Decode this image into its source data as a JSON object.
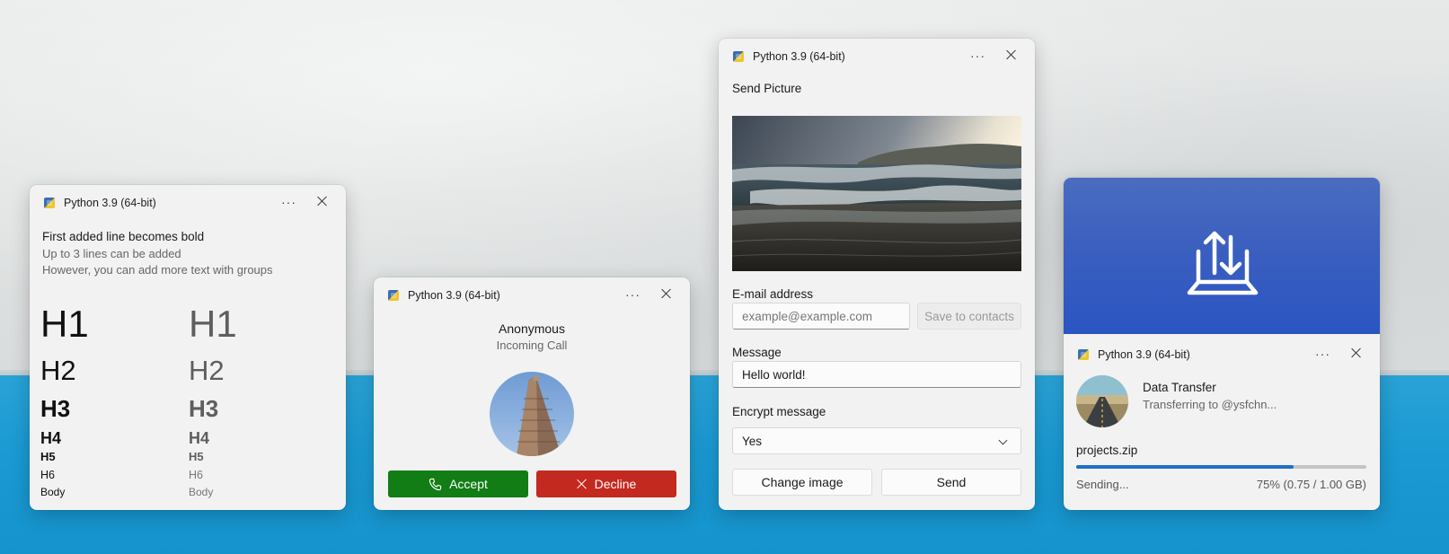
{
  "app_name": "Python 3.9 (64-bit)",
  "header": {
    "more_label": "···"
  },
  "toast_text": {
    "line1": "First added line becomes bold",
    "line2": "Up to 3 lines can be added",
    "line3": "However, you can add more text with groups",
    "headings": [
      "H1",
      "H2",
      "H3",
      "H4",
      "H5",
      "H6",
      "Body"
    ]
  },
  "toast_call": {
    "caller": "Anonymous",
    "subtitle": "Incoming Call",
    "accept_label": "Accept",
    "decline_label": "Decline",
    "accept_color": "#117d14",
    "decline_color": "#c4291f"
  },
  "toast_picture": {
    "title": "Send Picture",
    "email_label": "E-mail address",
    "email_placeholder": "example@example.com",
    "save_contacts_label": "Save to contacts",
    "message_label": "Message",
    "message_value": "Hello world!",
    "encrypt_label": "Encrypt message",
    "encrypt_value": "Yes",
    "change_image_label": "Change image",
    "send_label": "Send"
  },
  "toast_transfer": {
    "title": "Data Transfer",
    "subtitle": "Transferring to @ysfchn...",
    "file_name": "projects.zip",
    "status": "Sending...",
    "progress_text": "75% (0.75 / 1.00 GB)",
    "progress": 0.75,
    "hero_icon": "upload-laptop-icon",
    "accent": "#1f6fc4"
  }
}
